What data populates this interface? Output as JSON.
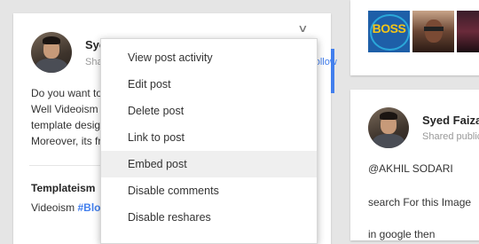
{
  "left_post": {
    "author": "Syed Faizan",
    "shared": "Shared publicly",
    "follow": "Follow",
    "lines": [
      "Do you want to use the best templates?",
      "Well Videoism is one of the best blogger",
      "template designs, responsive & elegant.",
      "Moreover, its free to download."
    ],
    "attachment_title": "Templateism",
    "attachment_text_prefix": "Videoism ",
    "attachment_tag": "#Blogger"
  },
  "menu": {
    "items": [
      {
        "label": "View post activity"
      },
      {
        "label": "Edit post"
      },
      {
        "label": "Delete post"
      },
      {
        "label": "Link to post"
      },
      {
        "label": "Embed post"
      },
      {
        "label": "Disable comments"
      },
      {
        "label": "Disable reshares"
      }
    ],
    "highlighted_index": 4
  },
  "right_top": {
    "thumbs": [
      {
        "name": "boss-thumbnail",
        "text": "BOSS"
      },
      {
        "name": "face-thumbnail"
      },
      {
        "name": "dark-thumbnail"
      }
    ]
  },
  "right_post": {
    "author": "Syed Faizan",
    "shared": "Shared publicly",
    "lines": [
      "@AKHIL SODARI",
      "search For this Image",
      "in google then"
    ]
  },
  "icons": {
    "chevron": "chevron-down-icon"
  },
  "colors": {
    "accent": "#427fed",
    "highlight": "#efefef"
  }
}
